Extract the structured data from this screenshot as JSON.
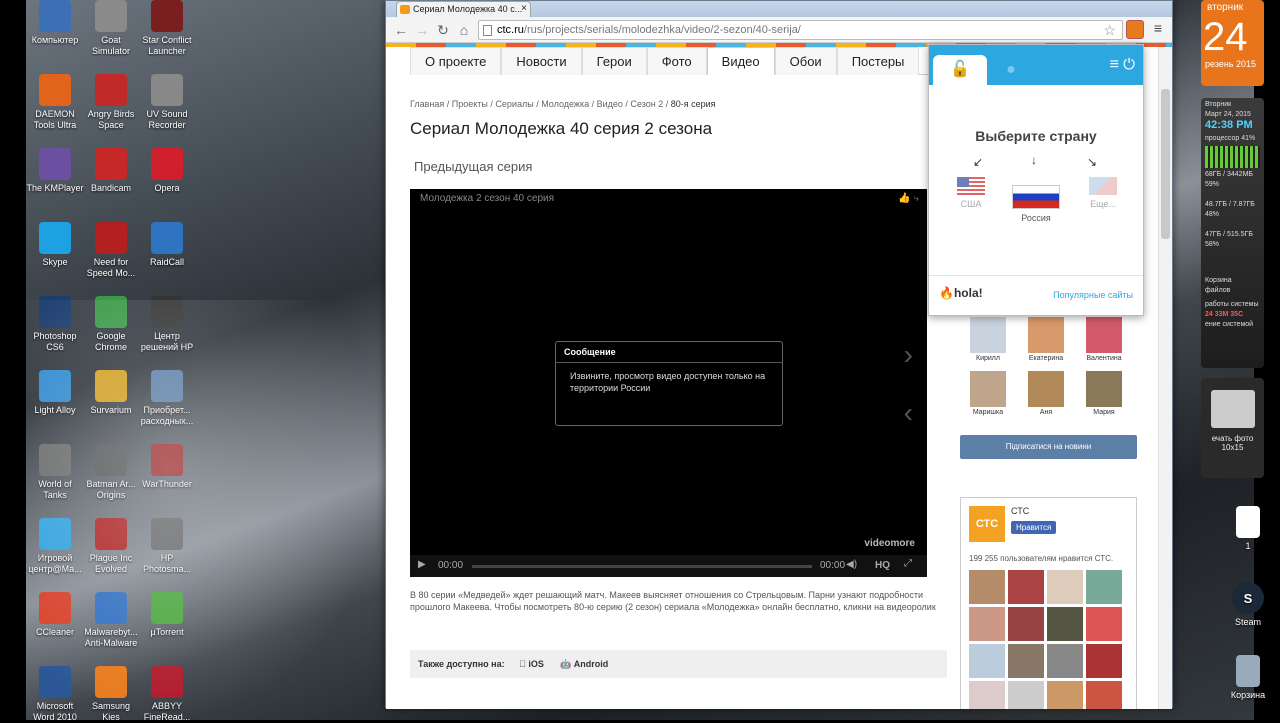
{
  "desktop": {
    "icons": [
      {
        "label": "Компьютер",
        "color": "#3b6fb6"
      },
      {
        "label": "Goat Simulator",
        "color": "#8a8a8a"
      },
      {
        "label": "Star Conflict Launcher",
        "color": "#7a1f1f"
      },
      {
        "label": "DAEMON Tools Ultra",
        "color": "#e2641c"
      },
      {
        "label": "Angry Birds Space",
        "color": "#c22a2a"
      },
      {
        "label": "UV Sound Recorder",
        "color": "#888888"
      },
      {
        "label": "The KMPlayer",
        "color": "#6b4fa0"
      },
      {
        "label": "Bandicam",
        "color": "#c62828"
      },
      {
        "label": "Opera",
        "color": "#d01f2f"
      },
      {
        "label": "Skype",
        "color": "#1da1e2"
      },
      {
        "label": "Need for Speed Mo...",
        "color": "#b32020"
      },
      {
        "label": "RaidCall",
        "color": "#2f74c0"
      },
      {
        "label": "Photoshop CS6",
        "color": "#1b3c6e"
      },
      {
        "label": "Google Chrome",
        "color": "#3a9b46"
      },
      {
        "label": "Центр решений HP",
        "color": "#333333"
      },
      {
        "label": "Light Alloy",
        "color": "#2f8bd1"
      },
      {
        "label": "Survarium",
        "color": "#d6a01b"
      },
      {
        "label": "Приобрет... расходных...",
        "color": "#5a7fa8"
      },
      {
        "label": "World of Tanks",
        "color": "#6b6b6b"
      },
      {
        "label": "Batman Ar... Origins",
        "color": "#555555"
      },
      {
        "label": "WarThunder",
        "color": "#a02020"
      },
      {
        "label": "Игровой центр@Ma...",
        "color": "#2fa3e0"
      },
      {
        "label": "Plague Inc Evolved",
        "color": "#b21e1e"
      },
      {
        "label": "HP Photosma...",
        "color": "#666666"
      },
      {
        "label": "CCleaner",
        "color": "#d9412a"
      },
      {
        "label": "Malwarebyt... Anti-Malware",
        "color": "#2f6fc2"
      },
      {
        "label": "µTorrent",
        "color": "#49a83b"
      },
      {
        "label": "Microsoft Word 2010",
        "color": "#2b5797"
      },
      {
        "label": "Samsung Kies",
        "color": "#e87a1c"
      },
      {
        "label": "ABBYY FineRead...",
        "color": "#b0182a"
      }
    ],
    "right_icons": [
      {
        "label": "1"
      },
      {
        "label": "Steam"
      },
      {
        "label": "Корзина"
      }
    ],
    "clock_gadget": {
      "day": "вторник",
      "date": "24",
      "month": "резень 2015"
    },
    "sysmon": {
      "day": "Вторник",
      "date": "Март 24, 2015",
      "time": "42:38 PM",
      "cpu_label": "процессор",
      "cpu": "41%",
      "lines": [
        "68ГБ / 3442МБ 59%",
        "48.7ГБ / 7.87ГБ 48%",
        "47ГБ / 515.5ГБ 58%"
      ],
      "trash": "Корзина",
      "files": "файлов",
      "uptime_label": "работы системы",
      "uptime": "24 33М 35С",
      "shutdown": "ение системой"
    },
    "printer_gadget": {
      "label": "ечать фото",
      "size": "10x15"
    }
  },
  "browser": {
    "tab_title": "Сериал Молодежка 40 с...",
    "url_domain": "ctc.ru",
    "url_path": "/rus/projects/serials/molodezhka/video/2-sezon/40-serija/",
    "nav_tabs": [
      "О проекте",
      "Новости",
      "Герои",
      "Фото",
      "Видео",
      "Обои",
      "Постеры"
    ],
    "active_tab": "Видео",
    "breadcrumbs": [
      "Главная",
      "Проекты",
      "Сериалы",
      "Молодежка",
      "Видео",
      "Сезон 2"
    ],
    "breadcrumb_current": "80-я серия",
    "page_title": "Сериал Молодежка 40 серия 2 сезона",
    "prev_episode": "Предыдущая серия",
    "video": {
      "title": "Молодежка 2 сезон 40 серия",
      "message_header": "Сообщение",
      "message_body": "Извините, просмотр видео доступен только на территории России",
      "time_start": "00:00",
      "time_end": "00:00",
      "hq": "HQ",
      "logo": "videomore"
    },
    "description": "В 80 серии «Медведей» ждет решающий матч. Макеев выясняет отношения со Стрельцовым. Парни узнают подробности прошлого Макеева. Чтобы посмотреть 80-ю серию (2 сезон) сериала «Молодежка» онлайн бесплатно, кликни на видеоролик",
    "available_label": "Также доступно на:",
    "platforms": [
      "iOS",
      "Android"
    ],
    "vk_friends": [
      "Кирилл",
      "Екатерина",
      "Валентина",
      "Маришка",
      "Аня",
      "Мария"
    ],
    "subscribe": "Підписатися на новини",
    "fb": {
      "name": "СТС",
      "logo": "СТС",
      "like": "Нравится",
      "count": "199 255 пользователям нравится СТС."
    }
  },
  "hola": {
    "title": "Выберите страну",
    "countries": [
      {
        "name": "США"
      },
      {
        "name": "Россия"
      },
      {
        "name": "Еще..."
      }
    ],
    "brand": "hola!",
    "popular": "Популярные сайты"
  }
}
